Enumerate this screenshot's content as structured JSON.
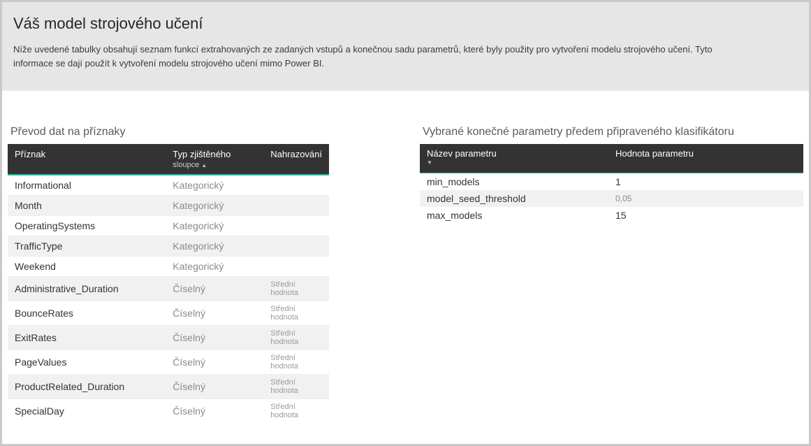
{
  "header": {
    "title": "Váš model strojového učení",
    "description": "Níže uvedené tabulky obsahují seznam funkcí extrahovaných ze zadaných vstupů a konečnou sadu parametrů, které byly použity pro vytvoření modelu strojového učení. Tyto informace se dají použít k vytvoření modelu strojového učení mimo Power BI."
  },
  "features": {
    "title": "Převod dat na příznaky",
    "columns": {
      "feature": "Příznak",
      "type_line1": "Typ zjištěného",
      "type_line2": "sloupce",
      "repl": "Nahrazování"
    },
    "rows": [
      {
        "feature": "Informational",
        "type": "Kategorický",
        "repl": ""
      },
      {
        "feature": "Month",
        "type": "Kategorický",
        "repl": ""
      },
      {
        "feature": "OperatingSystems",
        "type": "Kategorický",
        "repl": ""
      },
      {
        "feature": "TrafficType",
        "type": "Kategorický",
        "repl": ""
      },
      {
        "feature": "Weekend",
        "type": "Kategorický",
        "repl": ""
      },
      {
        "feature": "Administrative_Duration",
        "type": "Číselný",
        "repl": "Střední hodnota"
      },
      {
        "feature": "BounceRates",
        "type": "Číselný",
        "repl": "Střední hodnota"
      },
      {
        "feature": "ExitRates",
        "type": "Číselný",
        "repl": "Střední hodnota"
      },
      {
        "feature": "PageValues",
        "type": "Číselný",
        "repl": "Střední hodnota"
      },
      {
        "feature": "ProductRelated_Duration",
        "type": "Číselný",
        "repl": "Střední hodnota"
      },
      {
        "feature": "SpecialDay",
        "type": "Číselný",
        "repl": "Střední hodnota"
      }
    ]
  },
  "params": {
    "title": "Vybrané konečné parametry předem připraveného klasifikátoru",
    "columns": {
      "name": "Název parametru",
      "value": "Hodnota parametru"
    },
    "rows": [
      {
        "name": "min_models",
        "value": "1"
      },
      {
        "name": "model_seed_threshold",
        "value": "0,05"
      },
      {
        "name": "max_models",
        "value": "15"
      }
    ]
  }
}
